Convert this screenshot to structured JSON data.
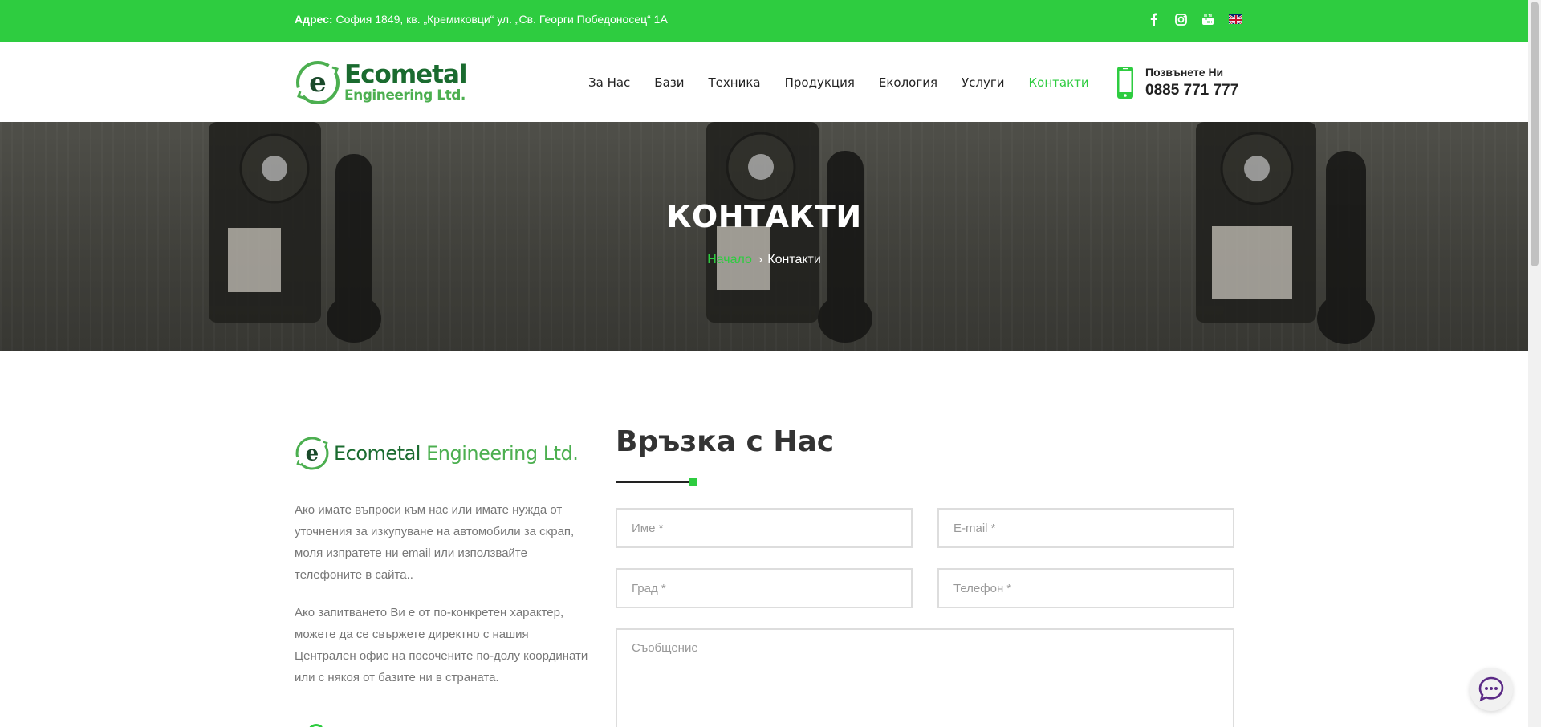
{
  "topbar": {
    "address_label": "Адрес:",
    "address_value": "София 1849, кв. „Кремиковци“ ул. „Св. Георги Победоносец“ 1А",
    "socials": [
      "facebook-icon",
      "instagram-icon",
      "youtube-icon",
      "english-flag-icon"
    ]
  },
  "header": {
    "logo_line1": "Ecometal",
    "logo_line2": "Engineering Ltd.",
    "nav": [
      {
        "label": "За Нас"
      },
      {
        "label": "Бази"
      },
      {
        "label": "Техника"
      },
      {
        "label": "Продукция"
      },
      {
        "label": "Екология"
      },
      {
        "label": "Услуги"
      },
      {
        "label": "Контакти",
        "active": true
      }
    ],
    "call_label": "Позвънете Ни",
    "call_number": "0885 771 777"
  },
  "hero": {
    "title": "КОНТАКТИ",
    "breadcrumb_home": "Начало",
    "breadcrumb_current": "Контакти"
  },
  "info": {
    "brand_part1": "Ecometal",
    "brand_part2": "Engineering Ltd.",
    "paragraph1": "Ако имате въпроси към нас или имате нужда от уточнения за изкупуване на автомобили за скрап, моля изпратете ни email или използвайте телефоните в сайта..",
    "paragraph2": "Ако запитването Ви е от по-конкретен характер, можете да се свържете директно с нашия Централен офис на посочените по-долу координати или с някоя от базите ни в страната."
  },
  "form": {
    "title": "Връзка с Нас",
    "name_placeholder": "Име *",
    "email_placeholder": "E-mail *",
    "city_placeholder": "Град *",
    "phone_placeholder": "Телефон *",
    "message_placeholder": "Съобщение"
  },
  "colors": {
    "accent": "#2ecc40",
    "logo_dark_green": "#1a6b2f",
    "text_muted": "#777777"
  }
}
